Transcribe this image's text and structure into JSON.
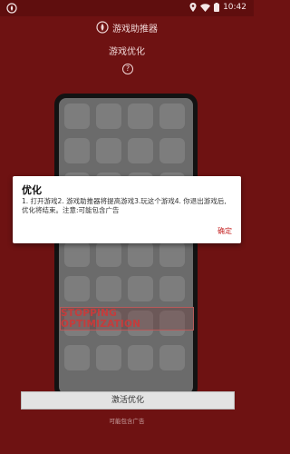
{
  "status_bar": {
    "time": "10:42",
    "icons": [
      "app-notification-icon",
      "location-icon",
      "wifi-icon",
      "battery-icon"
    ]
  },
  "header": {
    "title": "游戏助推器",
    "subtitle": "游戏优化",
    "help_glyph": "?"
  },
  "phone_preview": {
    "banner": "STOPPING OPTIMIZATION"
  },
  "dialog": {
    "title": "优化",
    "body": "1. 打开游戏2. 游戏助推器将提高游戏3.玩这个游戏4. 你退出游戏后,优化将结束。注意:可能包含广告",
    "ok_label": "确定"
  },
  "main": {
    "activate_label": "激活优化",
    "footer_note": "可能包含广告"
  },
  "colors": {
    "background": "#6e1212",
    "accent": "#c62828"
  }
}
